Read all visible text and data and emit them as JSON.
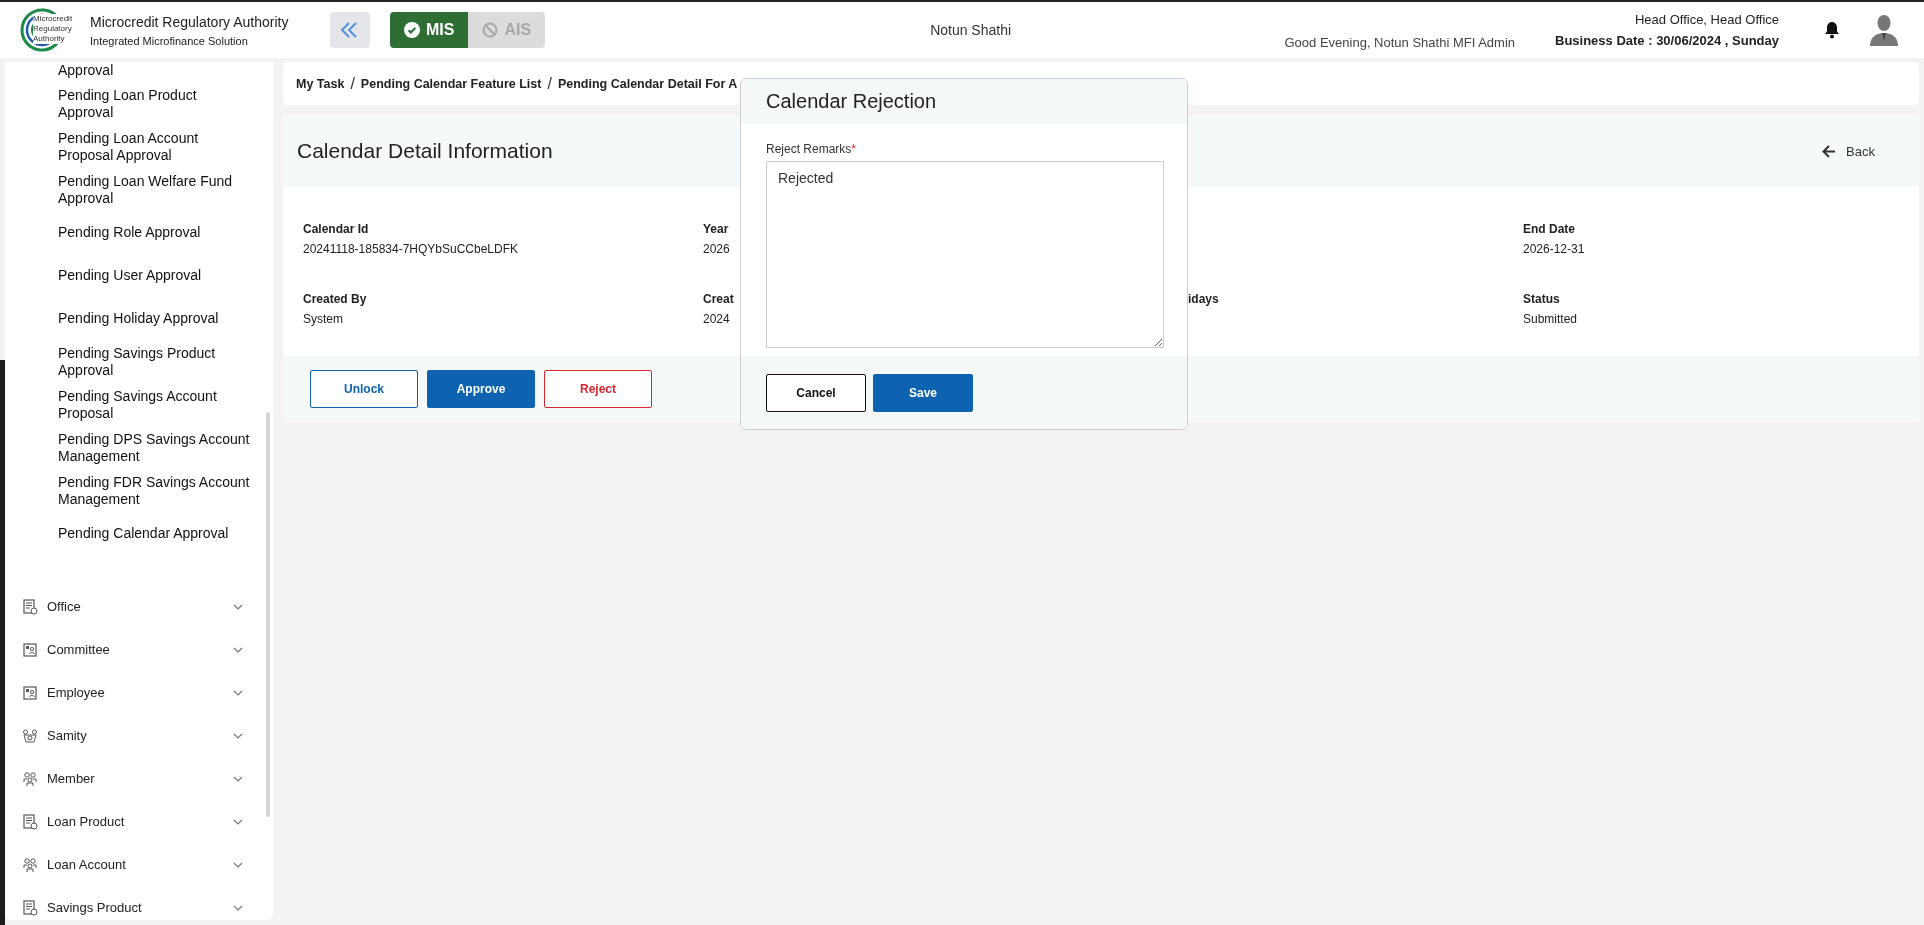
{
  "header": {
    "logo_text": "Microcredit Regulatory Authority",
    "title": "Microcredit Regulatory Authority",
    "subtitle": "Integrated Microfinance Solution",
    "modules": [
      {
        "label": "MIS",
        "selected": true
      },
      {
        "label": "AIS",
        "selected": false
      }
    ],
    "org_name": "Notun Shathi",
    "greeting": "Good Evening, Notun Shathi MFI Admin",
    "office": "Head Office, Head Office",
    "business_date": "Business Date : 30/06/2024 , Sunday"
  },
  "sidebar": {
    "submenu_items": [
      "Approval",
      "Pending Loan Product Approval",
      "Pending Loan Account Proposal Approval",
      "Pending Loan Welfare Fund Approval",
      "Pending Role Approval",
      "Pending User Approval",
      "Pending Holiday Approval",
      "Pending Savings Product Approval",
      "Pending Savings Account Proposal",
      "Pending DPS Savings Account Management",
      "Pending FDR Savings Account Management",
      "Pending Calendar Approval"
    ],
    "menu": [
      {
        "label": "Office",
        "kind": "document",
        "expanded": false
      },
      {
        "label": "Committee",
        "kind": "contact",
        "expanded": false
      },
      {
        "label": "Employee",
        "kind": "contact",
        "expanded": false
      },
      {
        "label": "Samity",
        "kind": "group",
        "expanded": false
      },
      {
        "label": "Member",
        "kind": "people",
        "expanded": false
      },
      {
        "label": "Loan Product",
        "kind": "document",
        "expanded": false
      },
      {
        "label": "Loan Account",
        "kind": "people",
        "expanded": false
      },
      {
        "label": "Savings Product",
        "kind": "document",
        "expanded": false
      }
    ]
  },
  "breadcrumb": [
    {
      "label": "My Task",
      "separator": "/"
    },
    {
      "label": "Pending Calendar Feature List",
      "separator": "/"
    },
    {
      "label": "Pending Calendar Detail For A"
    }
  ],
  "detail": {
    "title": "Calendar Detail Information",
    "back": "Back",
    "fields": [
      {
        "label": "Calendar Id",
        "value": "20241118-185834-7HQYbSuCCbeLDFK",
        "kind": "full"
      },
      {
        "label": "Year",
        "value": "2026",
        "kind": "cut"
      },
      {
        "kind": "hidden"
      },
      {
        "label": "End Date",
        "value": "2026-12-31",
        "kind": "full"
      },
      {
        "label": "Created By",
        "value": "System",
        "kind": "full"
      },
      {
        "label": "Creat",
        "value": "2024",
        "kind": "cut"
      },
      {
        "label": "idays",
        "kind": "tail"
      },
      {
        "label": "Status",
        "value": "Submitted",
        "kind": "full"
      }
    ],
    "buttons": [
      {
        "label": "Unlock",
        "kind": "outline"
      },
      {
        "label": "Approve",
        "kind": "primary"
      },
      {
        "label": "Reject",
        "kind": "danger"
      }
    ]
  },
  "modal": {
    "title": "Calendar Rejection",
    "field_label": "Reject Remarks",
    "required_mark": "*",
    "value": "Rejected",
    "buttons": [
      {
        "label": "Cancel",
        "kind": "outline"
      },
      {
        "label": "Save",
        "kind": "primary"
      }
    ]
  }
}
